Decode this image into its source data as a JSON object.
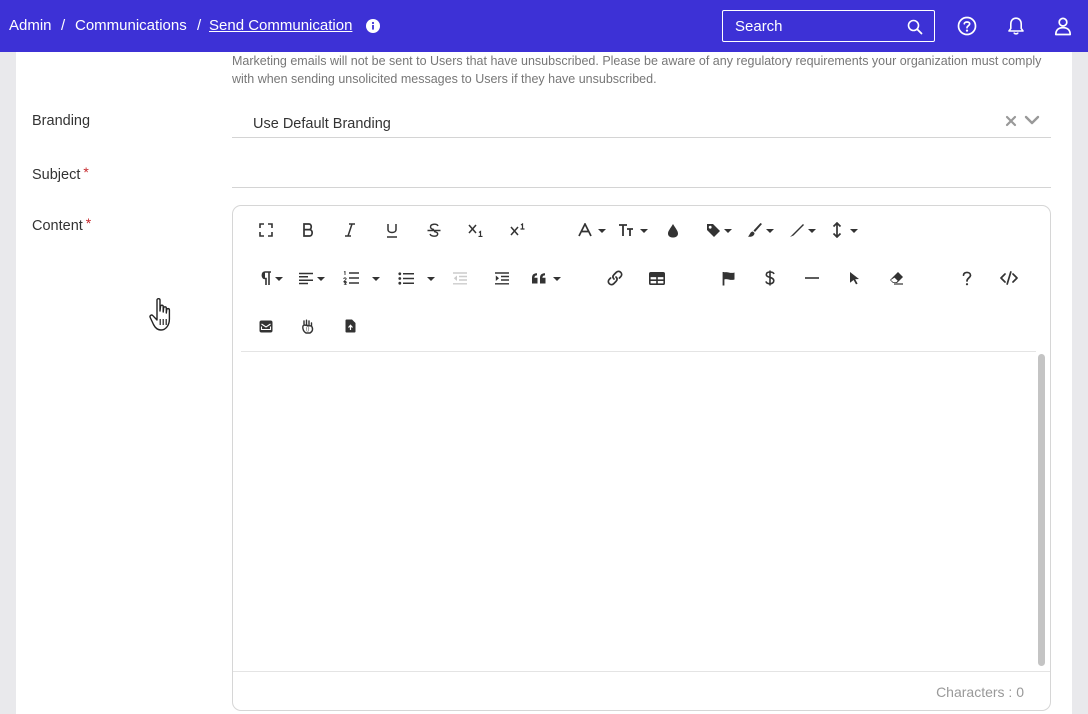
{
  "breadcrumb": {
    "items": [
      "Admin",
      "Communications",
      "Send Communication"
    ],
    "separator": "/"
  },
  "search": {
    "placeholder": "Search"
  },
  "header_icons": [
    "info-icon",
    "search-icon",
    "help-icon",
    "bell-icon",
    "user-icon"
  ],
  "notice": "Marketing emails will not be sent to Users that have unsubscribed. Please be aware of any regulatory requirements your organization must comply with when sending unsolicited messages to Users if they have unsubscribed.",
  "form": {
    "branding": {
      "label": "Branding",
      "value": "Use Default Branding"
    },
    "subject": {
      "label": "Subject",
      "required_mark": "*",
      "value": ""
    },
    "content": {
      "label": "Content",
      "required_mark": "*"
    }
  },
  "editor": {
    "toolbar_rows": [
      [
        "fullscreen",
        "bold",
        "italic",
        "underline",
        "strikethrough",
        "subscript",
        "superscript",
        "font-family",
        "font-size",
        "text-color",
        "tag",
        "highlight",
        "paint-format",
        "line-height"
      ],
      [
        "paragraph-format",
        "align",
        "ordered-list",
        "unordered-list",
        "outdent",
        "indent",
        "quote",
        "link",
        "table",
        "flag",
        "dollar",
        "horizontal-line",
        "select",
        "clear-formatting",
        "help",
        "code-view"
      ],
      [
        "email-template",
        "merge-field",
        "file-upload"
      ]
    ],
    "char_count_label": "Characters : 0"
  },
  "colors": {
    "header": "#3d31d6",
    "background": "#e9e9ec",
    "required": "#c6282c"
  }
}
